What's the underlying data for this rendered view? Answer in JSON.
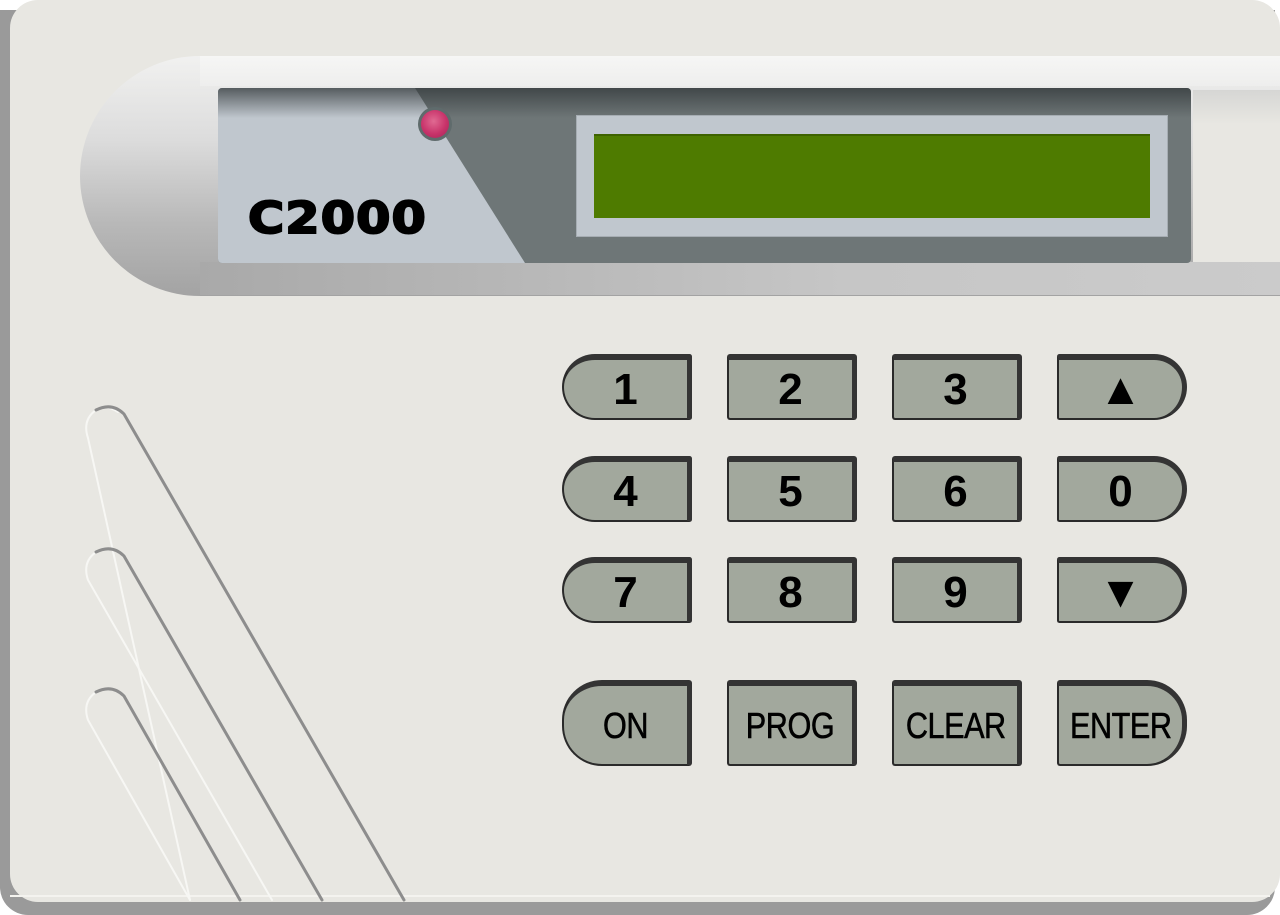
{
  "device": {
    "model_label": "C2000",
    "colors": {
      "body": "#e8e7e2",
      "panel_light": "#c0c7ce",
      "panel_dark": "#6e7677",
      "lcd": "#4e7b00",
      "led": "#c8336a",
      "key": "#a2a89d",
      "key_shadow": "#343434"
    },
    "led": {
      "name": "status-led",
      "state": "on"
    },
    "display": {
      "text": ""
    }
  },
  "keypad": {
    "rows": [
      [
        {
          "label": "1",
          "icon": null
        },
        {
          "label": "2",
          "icon": null
        },
        {
          "label": "3",
          "icon": null
        },
        {
          "label": "▲",
          "icon": "arrow-up-icon"
        }
      ],
      [
        {
          "label": "4",
          "icon": null
        },
        {
          "label": "5",
          "icon": null
        },
        {
          "label": "6",
          "icon": null
        },
        {
          "label": "0",
          "icon": null
        }
      ],
      [
        {
          "label": "7",
          "icon": null
        },
        {
          "label": "8",
          "icon": null
        },
        {
          "label": "9",
          "icon": null
        },
        {
          "label": "▼",
          "icon": "arrow-down-icon"
        }
      ]
    ],
    "function_keys": [
      {
        "label": "ON"
      },
      {
        "label": "PROG"
      },
      {
        "label": "CLEAR"
      },
      {
        "label": "ENTER"
      }
    ]
  }
}
